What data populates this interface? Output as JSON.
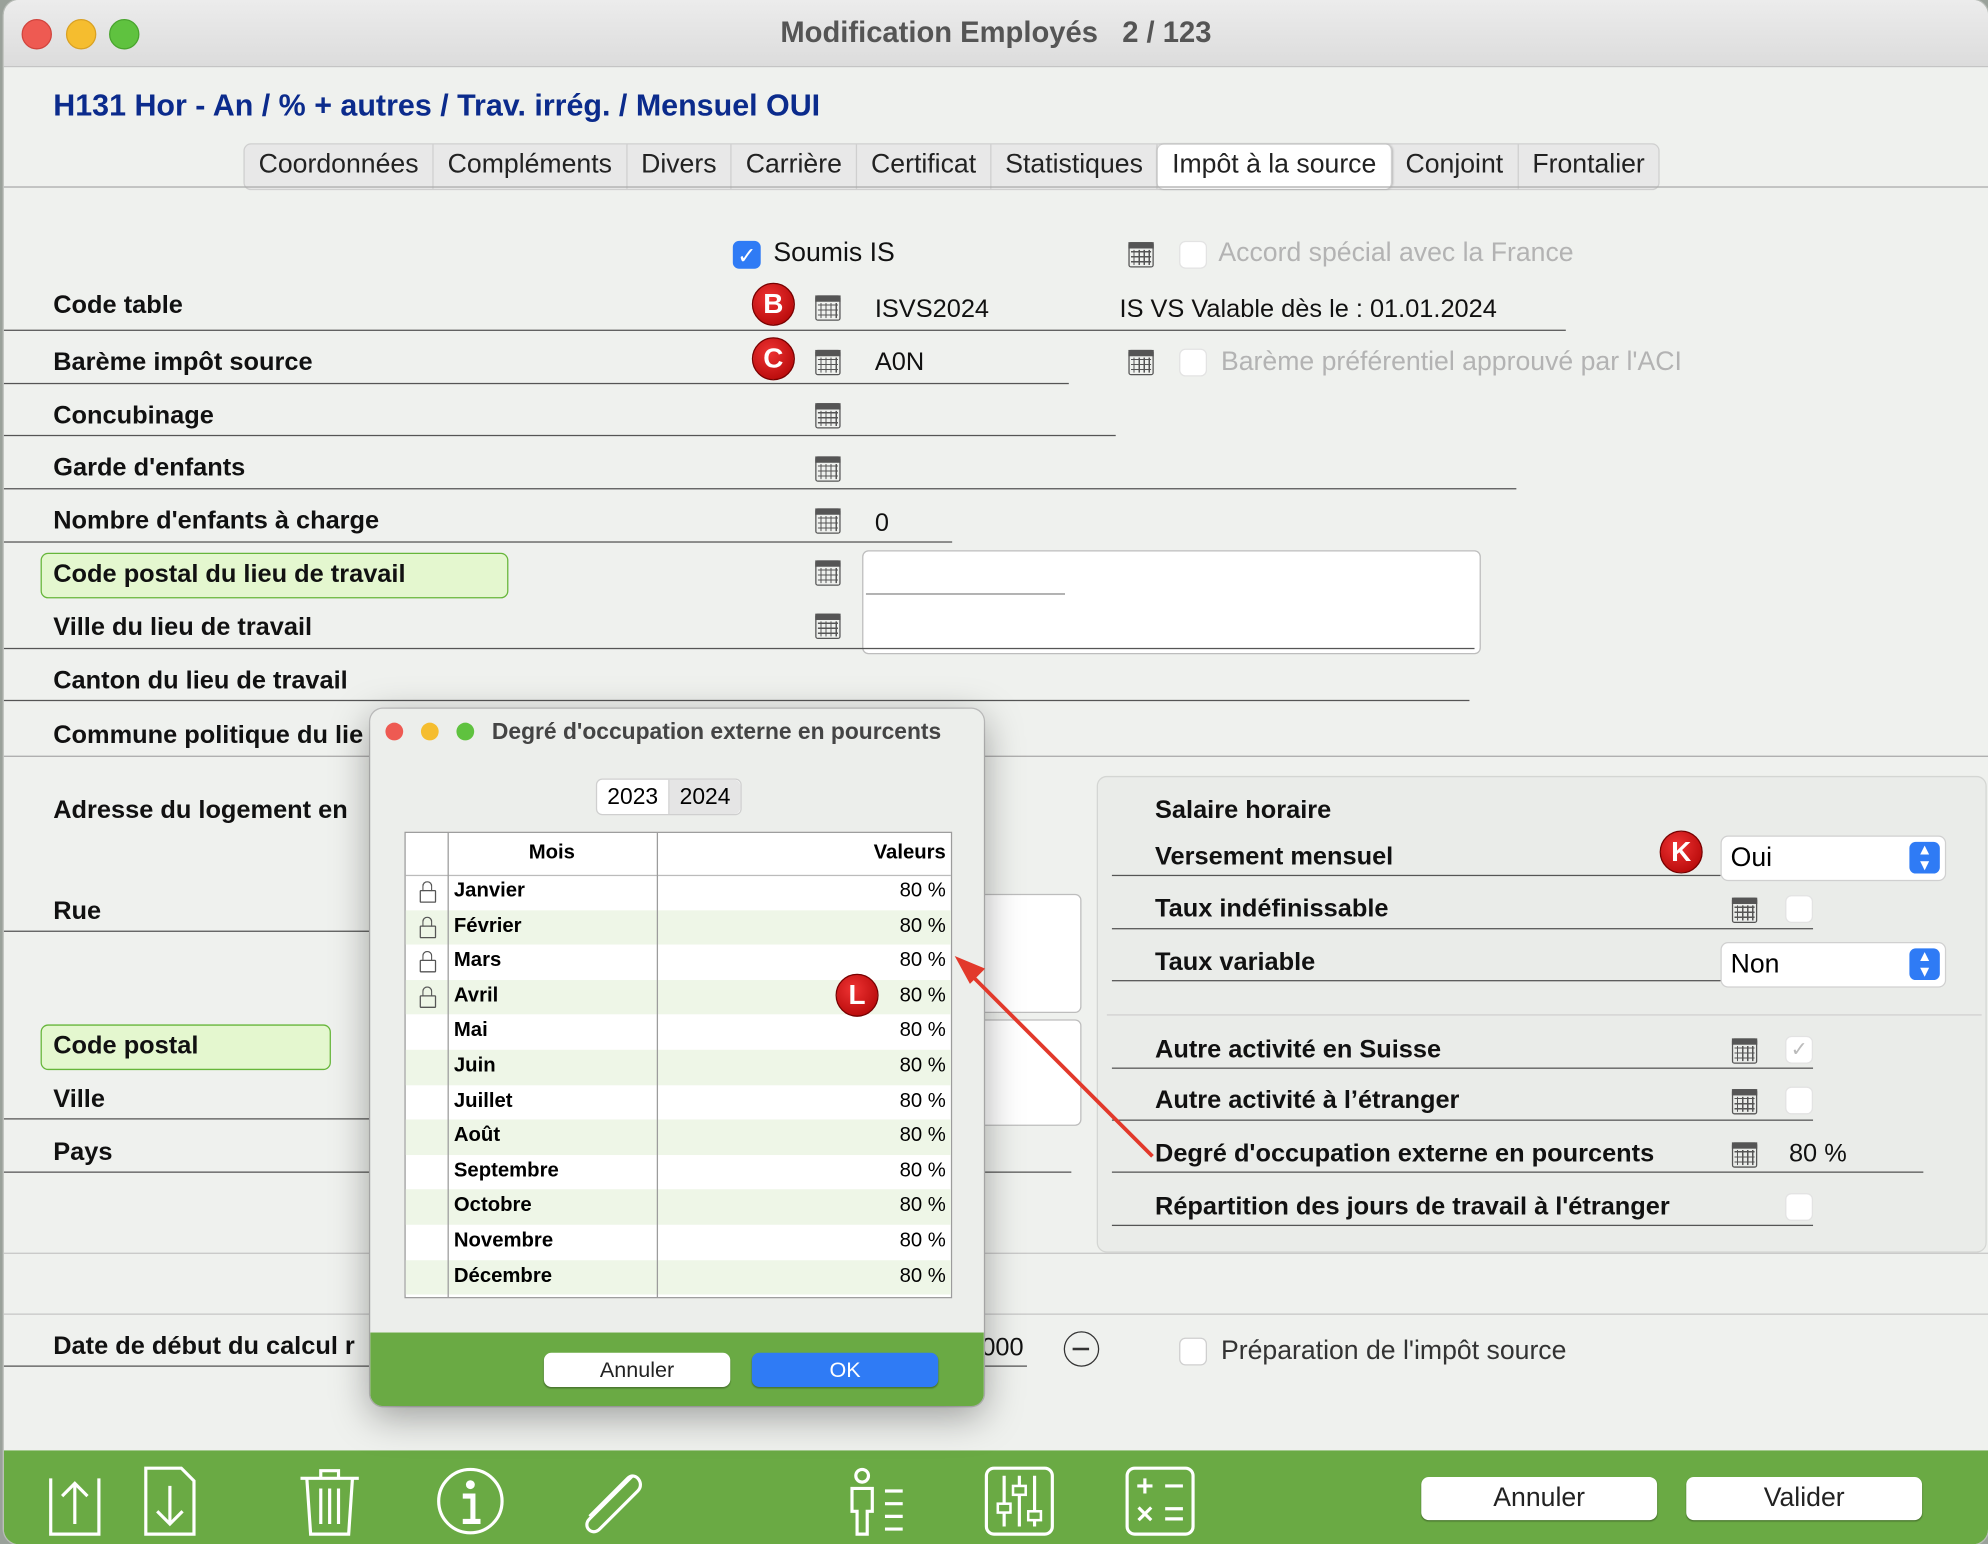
{
  "window": {
    "title": "Modification Employés   2 / 123"
  },
  "subtitle": "H131 Hor - An / % + autres / Trav. irrég. / Mensuel OUI",
  "tabs": [
    "Coordonnées",
    "Compléments",
    "Divers",
    "Carrière",
    "Certificat",
    "Statistiques",
    "Impôt à la source",
    "Conjoint",
    "Frontalier"
  ],
  "active_tab": "Impôt à la source",
  "top": {
    "soumis_is": "Soumis IS",
    "accord_france": "Accord spécial avec la France",
    "bareme_pref": "Barème préférentiel approuvé par l'ACI",
    "code_table_value": "ISVS2024",
    "code_table_info": "IS VS Valable dès le : 01.01.2024",
    "bareme_value": "A0N",
    "enfants_value": "0"
  },
  "labels": {
    "code_table": "Code table",
    "bareme": "Barème impôt source",
    "concubinage": "Concubinage",
    "garde": "Garde d'enfants",
    "enfants": "Nombre d'enfants à charge",
    "cp_travail": "Code postal du lieu de travail",
    "ville_travail": "Ville du lieu de travail",
    "canton_travail": "Canton du lieu de travail",
    "commune": "Commune politique du lie",
    "adresse": "Adresse du logement en",
    "rue": "Rue",
    "code_postal": "Code postal",
    "ville": "Ville",
    "pays": "Pays",
    "date_debut": "Date de début du calcul r",
    "date_partial": "000",
    "preparation": "Préparation de l'impôt source"
  },
  "badges": {
    "b": "B",
    "c": "C",
    "k": "K",
    "l": "L"
  },
  "right": {
    "salaire": "Salaire horaire",
    "versement": "Versement mensuel",
    "versement_value": "Oui",
    "taux_indef": "Taux indéfinissable",
    "taux_var": "Taux variable",
    "taux_var_value": "Non",
    "autre_suisse": "Autre activité en Suisse",
    "autre_etranger": "Autre activité à l’étranger",
    "degre": "Degré d'occupation externe en pourcents",
    "degre_value": "80 %",
    "repartition": "Répartition des jours de travail à l'étranger"
  },
  "dialog": {
    "title": "Degré d'occupation externe en pourcents",
    "years": [
      "2023",
      "2024"
    ],
    "selected_year": "2024",
    "col_mois": "Mois",
    "col_valeurs": "Valeurs",
    "rows": [
      {
        "mois": "Janvier",
        "valeur": "80 %",
        "locked": true
      },
      {
        "mois": "Février",
        "valeur": "80 %",
        "locked": true
      },
      {
        "mois": "Mars",
        "valeur": "80 %",
        "locked": true
      },
      {
        "mois": "Avril",
        "valeur": "80 %",
        "locked": true
      },
      {
        "mois": "Mai",
        "valeur": "80 %",
        "locked": false
      },
      {
        "mois": "Juin",
        "valeur": "80 %",
        "locked": false
      },
      {
        "mois": "Juillet",
        "valeur": "80 %",
        "locked": false
      },
      {
        "mois": "Août",
        "valeur": "80 %",
        "locked": false
      },
      {
        "mois": "Septembre",
        "valeur": "80 %",
        "locked": false
      },
      {
        "mois": "Octobre",
        "valeur": "80 %",
        "locked": false
      },
      {
        "mois": "Novembre",
        "valeur": "80 %",
        "locked": false
      },
      {
        "mois": "Décembre",
        "valeur": "80 %",
        "locked": false
      }
    ],
    "cancel": "Annuler",
    "ok": "OK"
  },
  "footer": {
    "cancel": "Annuler",
    "validate": "Valider",
    "icons": [
      "upload-icon",
      "download-icon",
      "trash-icon",
      "info-icon",
      "paperclip-icon",
      "person-list-icon",
      "sliders-icon",
      "calculator-icon"
    ]
  },
  "colors": {
    "accent_green": "#6aaa44",
    "highlight_green": "#e4f7cf",
    "title_blue": "#0b2b8c",
    "badge_red": "#cc1111",
    "checkbox_blue": "#2f7bf5"
  }
}
